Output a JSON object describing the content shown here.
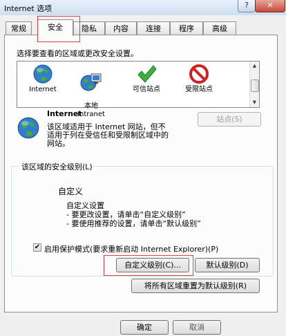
{
  "window": {
    "title": "Internet 选项",
    "help_glyph": "?",
    "close_glyph": "✕"
  },
  "tabs": [
    {
      "label": "常规"
    },
    {
      "label": "安全"
    },
    {
      "label": "隐私"
    },
    {
      "label": "内容"
    },
    {
      "label": "连接"
    },
    {
      "label": "程序"
    },
    {
      "label": "高级"
    }
  ],
  "zones": {
    "prompt": "选择要查看的区域或更改安全设置。",
    "items": [
      {
        "label": "Internet",
        "icon": "globe-icon"
      },
      {
        "label": "本地\nIntranet",
        "icon": "intranet-icon"
      },
      {
        "label": "可信站点",
        "icon": "checkmark-icon"
      },
      {
        "label": "受限站点",
        "icon": "restricted-icon"
      }
    ]
  },
  "selected_zone": {
    "name": "Internet",
    "description": "该区域适用于 Internet 网站，但不适用于列在受信任和受限制区域中的网站。",
    "sites_button": "站点(S)"
  },
  "security_level": {
    "label": "该区域的安全级别(L)",
    "title": "自定义",
    "lines": [
      "自定义设置",
      "- 要更改设置，请单击“自定义级别”",
      "- 要使用推荐的设置，请单击“默认级别”"
    ],
    "protected_mode_label": "启用保护模式(要求重新启动 Internet Explorer)(P)",
    "protected_mode_checked": true,
    "custom_level_button": "自定义级别(C)...",
    "default_level_button": "默认级别(D)",
    "reset_all_button": "将所有区域重置为默认级别(R)"
  },
  "footer": {
    "ok_button": "确定",
    "cancel_button": "取消"
  }
}
